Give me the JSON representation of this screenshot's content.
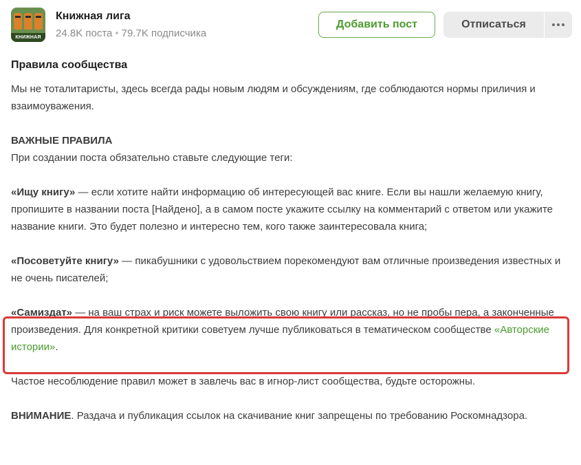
{
  "community": {
    "name": "Книжная лига",
    "avatar_text": "КНИЖНАЯ ЛИГА",
    "posts": "24.8K поста",
    "subscribers": "79.7K подписчика"
  },
  "buttons": {
    "add_post": "Добавить пост",
    "unsubscribe": "Отписаться"
  },
  "rules": {
    "heading": "Правила сообщества",
    "intro": "Мы не тоталитаристы, здесь всегда рады новым людям и обсуждениям, где соблюдаются нормы приличия и взаимоуважения.",
    "important_title": "ВАЖНЫЕ ПРАВИЛА",
    "important_text": "При создании поста обязательно ставьте следующие теги:",
    "tag1_name": "«Ищу книгу»",
    "tag1_text": " — если хотите найти информацию об интересующей вас книге. Если вы нашли желаемую книгу, пропишите в названии поста [Найдено], а в самом посте укажите ссылку на комментарий с ответом или укажите название книги. Это будет полезно и интересно тем, кого также заинтересовала книга;",
    "tag2_name": "«Посоветуйте книгу»",
    "tag2_text": " — пикабушники с удовольствием порекомендуют вам отличные произведения известных и не очень писателей;",
    "tag3_name": "«Самиздат»",
    "tag3_text": " — на ваш страх и риск можете выложить свою книгу или рассказ, но не пробы пера, а законченные произведения. Для конкретной критики советуем лучше публиковаться в тематическом сообществе ",
    "tag3_link": "«Авторские истории»",
    "tag3_end": ".",
    "warning_text": "Частое несоблюдение правил может в завлечь вас в игнор-лист сообщества, будьте осторожны.",
    "attention_title": "ВНИМАНИЕ",
    "attention_text": ". Раздача и публикация ссылок на скачивание книг запрещены по требованию Роскомнадзора."
  },
  "colors": {
    "accent_green": "#4b9b2e",
    "highlight_red": "#d93a36"
  }
}
